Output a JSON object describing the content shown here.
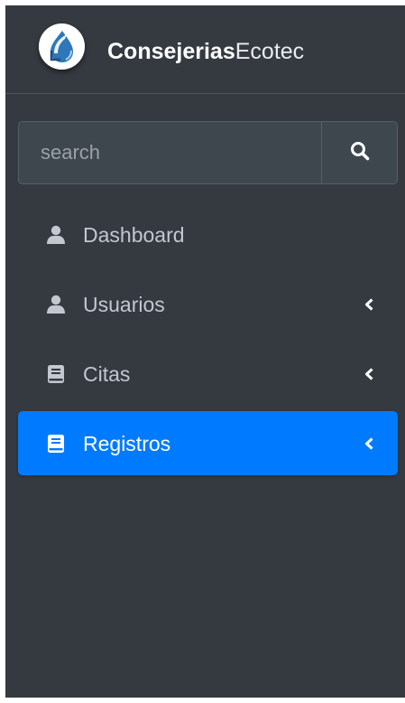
{
  "colors": {
    "sidebar_bg": "#343a40",
    "active_bg": "#007bff",
    "nav_text": "#c2c7d0",
    "active_text": "#ffffff"
  },
  "brand": {
    "logo_icon": "water-drop-logo",
    "name_bold": "Consejerias",
    "name_light": "Ecotec"
  },
  "search": {
    "placeholder": "search",
    "value": "",
    "button_icon": "search-icon"
  },
  "nav": {
    "items": [
      {
        "label": "Dashboard",
        "icon": "user-icon",
        "has_chevron": false,
        "active": false
      },
      {
        "label": "Usuarios",
        "icon": "user-icon",
        "has_chevron": true,
        "active": false
      },
      {
        "label": "Citas",
        "icon": "book-icon",
        "has_chevron": true,
        "active": false
      },
      {
        "label": "Registros",
        "icon": "book-icon",
        "has_chevron": true,
        "active": true
      }
    ]
  }
}
